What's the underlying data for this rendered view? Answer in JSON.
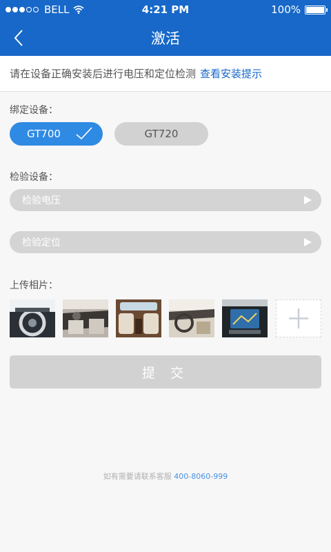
{
  "status_bar": {
    "carrier": "BELL",
    "time": "4:21 PM",
    "battery": "100%",
    "signal_bars_filled": 3,
    "signal_bars_total": 5
  },
  "nav": {
    "title": "激活",
    "back_icon": "chevron-left-icon"
  },
  "tip": {
    "text": "请在设备正确安装后进行电压和定位检测",
    "link": "查看安装提示"
  },
  "bind_section": {
    "label": "绑定设备：",
    "devices": [
      {
        "label": "GT700",
        "selected": true
      },
      {
        "label": "GT720",
        "selected": false
      }
    ]
  },
  "check_section": {
    "label": "检验设备：",
    "items": [
      {
        "label": "检验电压"
      },
      {
        "label": "检验定位"
      }
    ]
  },
  "upload_section": {
    "label": "上传相片：",
    "photos": [
      "steering-wheel-photo",
      "dashboard-photo",
      "rear-seats-photo",
      "front-cabin-photo",
      "navigation-screen-photo"
    ],
    "add_icon": "plus-icon"
  },
  "submit_label": "提 交",
  "service": {
    "text": "如有需要请联系客服",
    "phone": "400-8060-999"
  },
  "colors": {
    "primary": "#1768c8",
    "selected": "#2f8ae4",
    "disabled": "#d2d2d2",
    "background": "#f7f7f7"
  }
}
